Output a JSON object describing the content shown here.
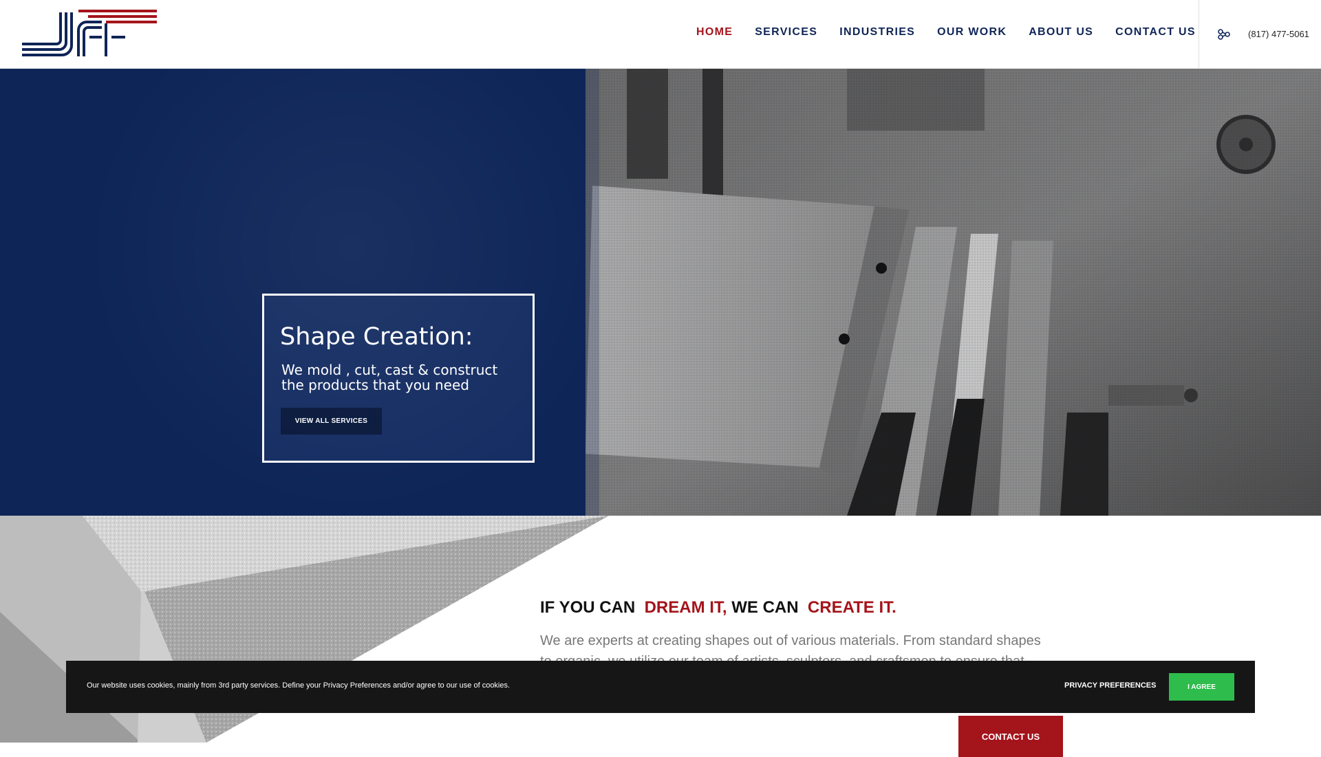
{
  "header": {
    "logo": {
      "text": "JCF",
      "icon": "jcf-logo"
    },
    "nav": [
      {
        "label": "HOME",
        "active": true
      },
      {
        "label": "SERVICES",
        "active": false
      },
      {
        "label": "INDUSTRIES",
        "active": false
      },
      {
        "label": "OUR WORK",
        "active": false
      },
      {
        "label": "ABOUT US",
        "active": false
      },
      {
        "label": "CONTACT US",
        "active": false
      }
    ],
    "phone": {
      "icon": "phone-icon",
      "text": "(817) 477-5061"
    }
  },
  "hero": {
    "title": "Shape Creation:",
    "subtitle": "We mold , cut, cast & construct the products that you need",
    "button_label": "VIEW ALL SERVICES"
  },
  "intro": {
    "headline_part1": "IF YOU CAN",
    "headline_red1": "DREAM IT,",
    "headline_part2": "WE CAN",
    "headline_red2": "CREATE IT.",
    "body": "We are experts at creating shapes out of various materials. From standard shapes to organic, we utilize our team of artists, sculptors, and craftsmen to ensure that every project adheres to JCF's rigid quality standards. Our team creates everything from trade show exhibits and seasonal decorations to foam trim and cast stone.",
    "contact_button": "CONTACT US"
  },
  "cookie": {
    "text": "Our website uses cookies, mainly from 3rd party services. Define your Privacy Preferences and/or agree to our use of cookies.",
    "privacy_label": "PRIVACY PREFERENCES",
    "agree_label": "I AGREE"
  },
  "colors": {
    "navy": "#0e2558",
    "red": "#a4141b",
    "green": "#2ebc4c",
    "nav_text": "#0f2557"
  }
}
